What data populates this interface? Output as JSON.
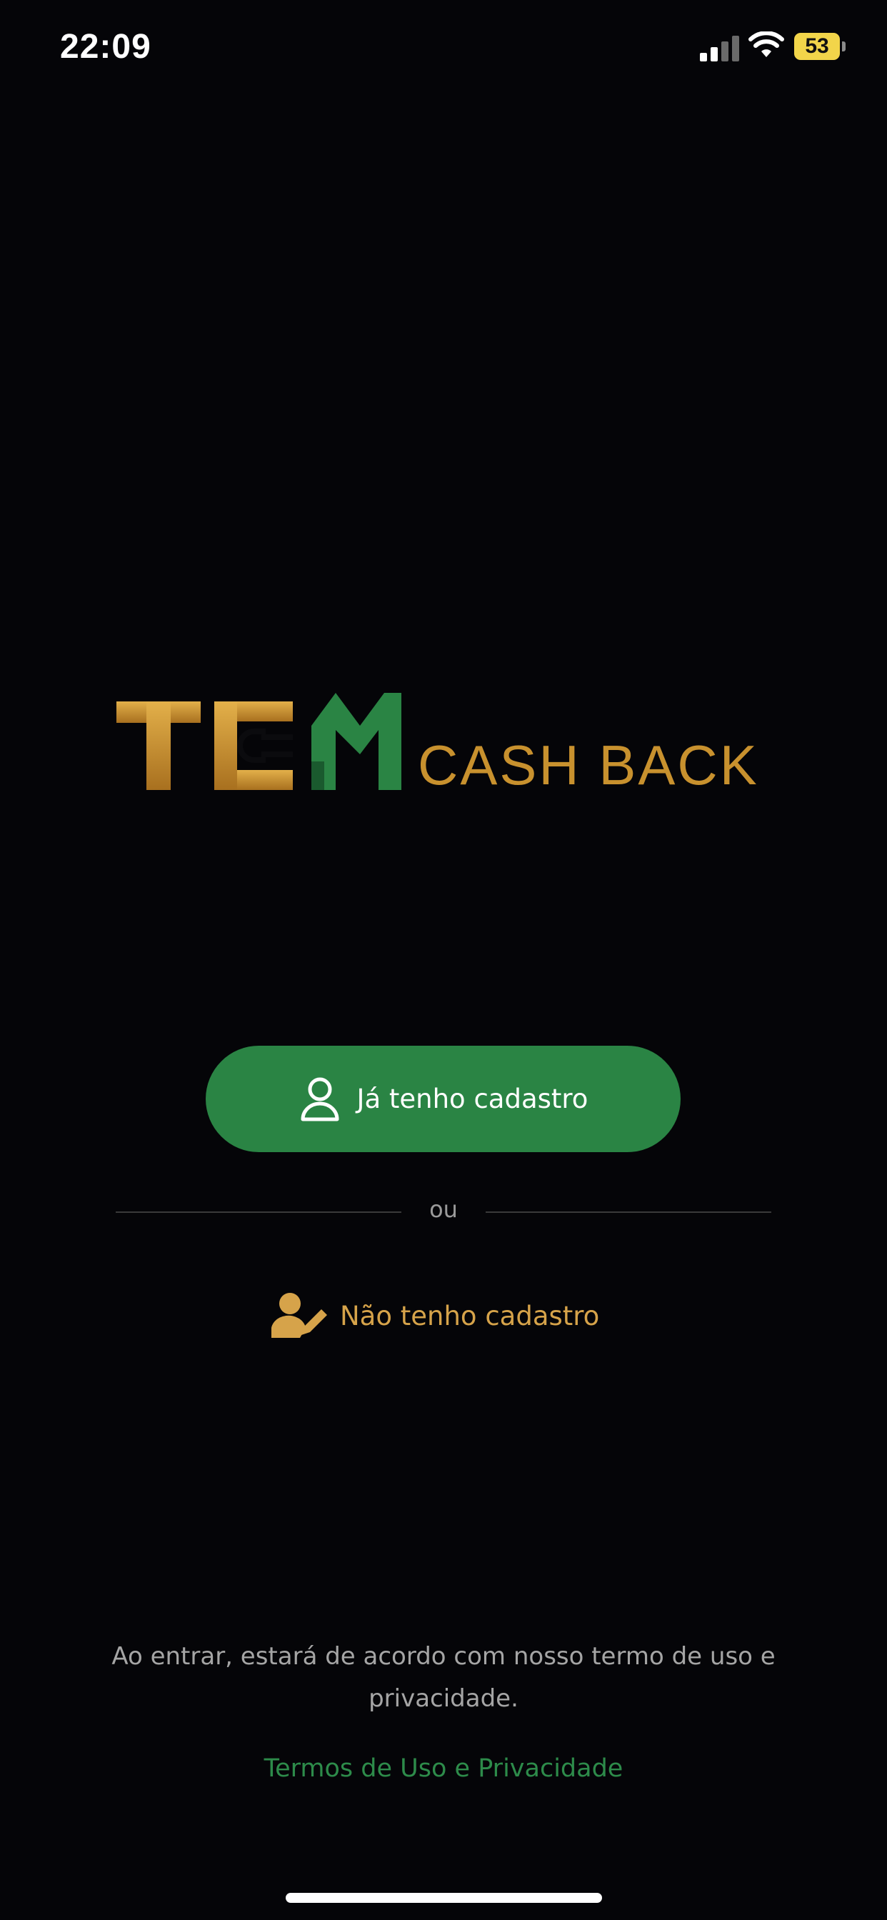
{
  "status_bar": {
    "time": "22:09",
    "battery_level": "53",
    "icons": [
      "signal-icon",
      "wifi-icon",
      "battery-icon"
    ]
  },
  "logo": {
    "brand_primary": "TEM",
    "brand_secondary": "CASH BACK",
    "colors": {
      "gold": "#c8912e",
      "green": "#2a8444"
    }
  },
  "actions": {
    "login_label": "Já tenho cadastro",
    "login_icon": "user-icon",
    "divider_label": "ou",
    "signup_label": "Não tenho cadastro",
    "signup_icon": "user-edit-icon"
  },
  "footer": {
    "legal_text": "Ao entrar, estará de acordo com nosso termo de uso e privacidade.",
    "terms_link": "Termos de Uso e Privacidade"
  },
  "colors": {
    "background": "#050508",
    "accent_green": "#2a8444",
    "accent_gold": "#d6a34a",
    "muted_text": "#a5a5a5"
  }
}
